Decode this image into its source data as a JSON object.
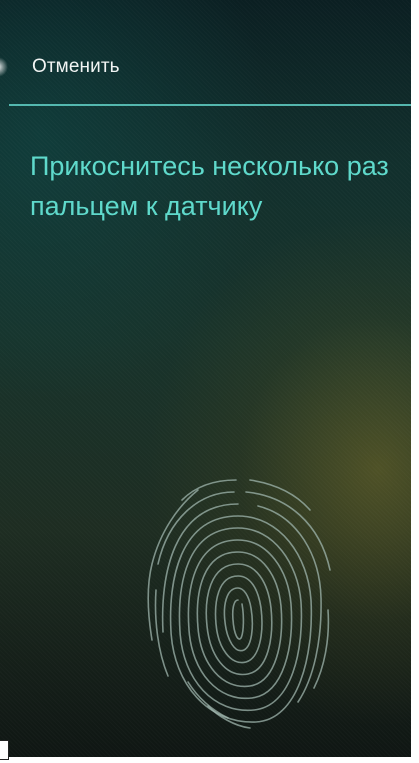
{
  "header": {
    "cancel_label": "Отменить"
  },
  "main": {
    "instruction": "Прикоснитесь несколько раз пальцем к датчику",
    "icon": "fingerprint-icon"
  },
  "colors": {
    "accent": "#5ed9cb",
    "divider": "#5fcfc4",
    "header_text": "#f1f4f3",
    "fingerprint": "#9fb6ad"
  }
}
